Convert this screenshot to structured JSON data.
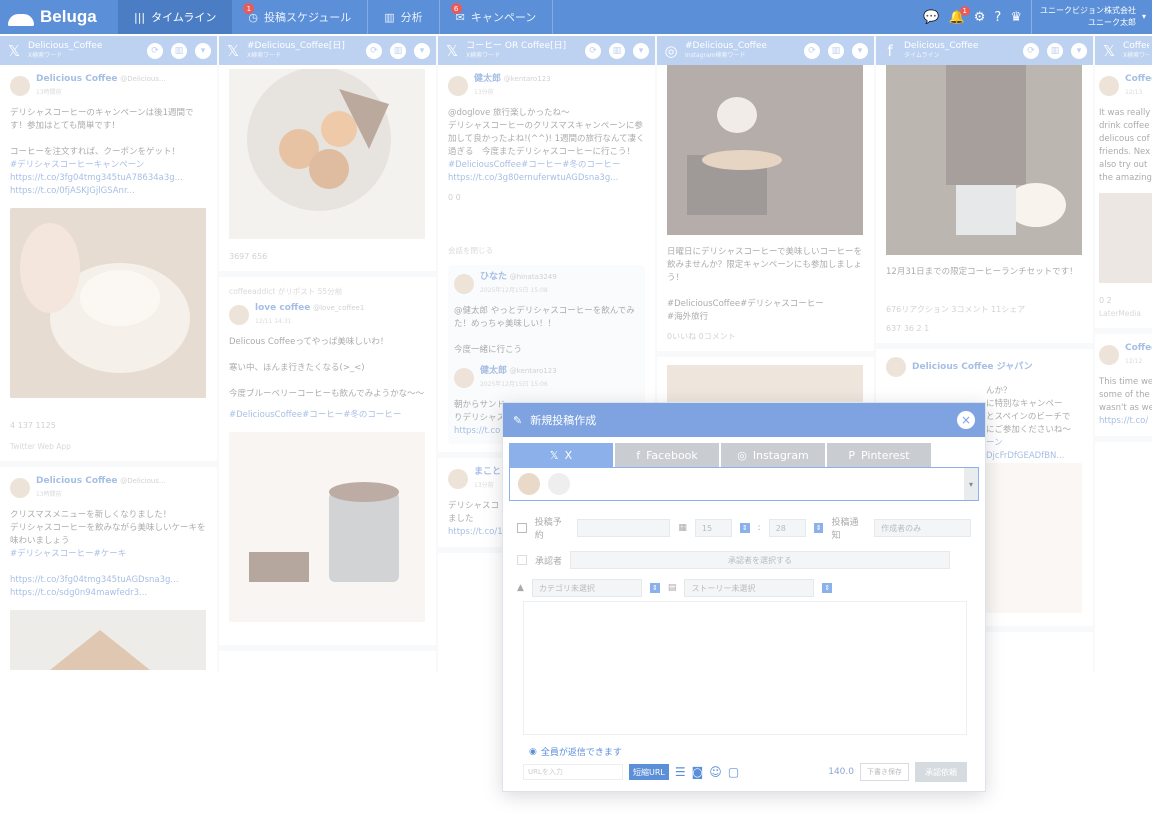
{
  "topbar": {
    "logo": "Beluga",
    "tabs": [
      {
        "label": "タイムライン",
        "icon": "bars-icon",
        "badge": ""
      },
      {
        "label": "投稿スケジュール",
        "icon": "clock-icon",
        "badge": "1"
      },
      {
        "label": "分析",
        "icon": "chart-icon",
        "badge": ""
      },
      {
        "label": "キャンペーン",
        "icon": "megaphone-icon",
        "badge": "6"
      }
    ],
    "notif_badge": "1",
    "account_company": "ユニークビジョン株式会社",
    "account_user": "ユニーク太郎"
  },
  "columns": [
    {
      "brand": "𝕏",
      "title": "Delicious_Coffee",
      "subtitle": "X検索ワード",
      "posts": [
        {
          "name": "Delicious Coffee",
          "handle": "@Delicious...",
          "time": "13時間前",
          "text": "デリシャスコーヒーのキャンペーンは後1週間です！参加はとても簡単です！\n\nコーヒーを注文すれば、クーポンをゲット！",
          "tags": "#デリシャスコーヒーキャンペーン\nhttps://t.co/3fg04tmg345tuA78634a3g...\nhttps://t.co/0fjASKJGjlGSAnr...",
          "actions": "4   137   1125",
          "footer": "Twitter Web App"
        },
        {
          "name": "Delicious Coffee",
          "handle": "@Delicious...",
          "time": "13時間前",
          "text": "クリスマスメニューを新しくなりました！\nデリシャスコーヒーを飲みながら美味しいケーキを味わいましょう",
          "tags": "#デリシャスコーヒー#ケーキ\n\nhttps://t.co/3fg04tmg345tuAGDsna3g...\nhttps://t.co/sdg0n94mawfedr3...",
          "actions": "",
          "footer": ""
        }
      ]
    },
    {
      "brand": "𝕏",
      "title": "#Delicious_Coffee[日]",
      "subtitle": "X検索ワード",
      "posts": [
        {
          "name": "love coffee",
          "handle": "@love_coffee1",
          "time": "12/11 14:31",
          "repost": "coffeeaddict がリポスト",
          "repost_time": "55分前",
          "text": "Delicous Coffeeってやっぱ美味しいわ！\n\n寒い中、ほんま行きたくなる(>_<)\n\n今度ブルーベリーコーヒーも飲んでみようかな〜〜",
          "tags": "#DeliciousCoffee#コーヒー#冬のコーヒー",
          "actions": "3697   656",
          "footer": ""
        }
      ]
    },
    {
      "brand": "𝕏",
      "title": "コーヒー OR Coffee[日]",
      "subtitle": "X検索ワード",
      "posts": [
        {
          "name": "健太郎",
          "handle": "@kentaro123",
          "time": "13分前",
          "text": "@doglove 旅行楽しかったね〜\nデリシャスコーヒーのクリスマスキャンペーンに参加して良かったよね!(^^)! 1週間の旅行なんて凄く過ぎる　今度またデリシャスコーヒーに行こう！",
          "tags": "#DeliciousCoffee#コーヒー#冬のコーヒー\nhttps://t.co/3g80ernuferwtuAGDsna3g...",
          "actions": "0   0",
          "footer": ""
        },
        {
          "name": "ひなた",
          "handle": "@hinata3249",
          "time": "2025年12月15日 15:08",
          "text": "@健太郎 やっとデリシャスコーヒーを飲んでみた！めっちゃ美味しい！！\n\n今度一緒に行こう",
          "tags": "",
          "actions": "",
          "footer": "",
          "thread_close": "会話を閉じる"
        },
        {
          "name": "健太郎",
          "handle": "@kentaro123",
          "time": "2025年12月15日 15:06",
          "text": "朝からサンド\nりデリシャス",
          "tags": "https://t.co",
          "actions": "",
          "footer": ""
        },
        {
          "name": "まこと",
          "handle": "",
          "time": "13分前",
          "text": "デリシャスコ\nました",
          "tags": "https://t.co/1",
          "actions": "",
          "footer": ""
        }
      ]
    },
    {
      "brand": "◎",
      "title": "#Delicious_Coffee",
      "subtitle": "Instagram検索ワード",
      "posts": [
        {
          "name": "",
          "handle": "",
          "time": "",
          "text": "日曜日にデリシャスコーヒーで美味しいコーヒーを飲みませんか？限定キャンペーンにも参加しましょう！\n\n#DeliciousCoffee#デリシャスコーヒー\n#海外旅行",
          "tags": "",
          "actions": "0いいね   0コメント",
          "footer": ""
        }
      ]
    },
    {
      "brand": "f",
      "title": "Delicious_Coffee",
      "subtitle": "タイムライン",
      "posts": [
        {
          "name": "",
          "handle": "",
          "time": "",
          "text": "12月31日までの限定コーヒーランチセットです！",
          "tags": "",
          "actions": "676リアクション   3コメント   11シェア",
          "reactions": "637   36   2   1",
          "footer": ""
        },
        {
          "name": "Delicious Coffee ジャパン",
          "handle": "",
          "time": "",
          "text": "んか？\nに特別なキャンペー\nとスペインのビーチで\nにご参加くださいね〜",
          "tags": "ーン\nDjcFrDfGEADfBN...",
          "actions": "",
          "footer": ""
        }
      ]
    },
    {
      "brand": "𝕏",
      "title": "CoffeeB",
      "subtitle": "X検索ワード",
      "posts": [
        {
          "name": "Coffee",
          "handle": "",
          "time": "12/13",
          "text": "It was really\ndrink coffee\ndelicous cof\nfriends. Nex\nalso try out\nthe amazing",
          "tags": "",
          "actions": "0   2",
          "footer": "LaterMedia"
        },
        {
          "name": "Coffee",
          "handle": "",
          "time": "12/12",
          "text": "This time we\nsome of the\nwasn't as we",
          "tags": "https://t.co/",
          "actions": "",
          "footer": ""
        }
      ]
    }
  ],
  "modal": {
    "title": "新規投稿作成",
    "sns_tabs": [
      "X",
      "Facebook",
      "Instagram",
      "Pinterest"
    ],
    "schedule_label": "投稿予約",
    "hour": "15",
    "minute": "28",
    "notify_label": "投稿通知",
    "notify_placeholder": "作成者のみ",
    "approver_label": "承認者",
    "approver_button": "承認者を選択する",
    "category_placeholder": "カテゴリ未選択",
    "story_placeholder": "ストーリー未選択",
    "reply_label": "全員が返信できます",
    "url_placeholder": "URLを入力",
    "short_url": "短縮URL",
    "count": "140.0",
    "draft_button": "下書き保存",
    "apply_button": "承認依頼"
  }
}
